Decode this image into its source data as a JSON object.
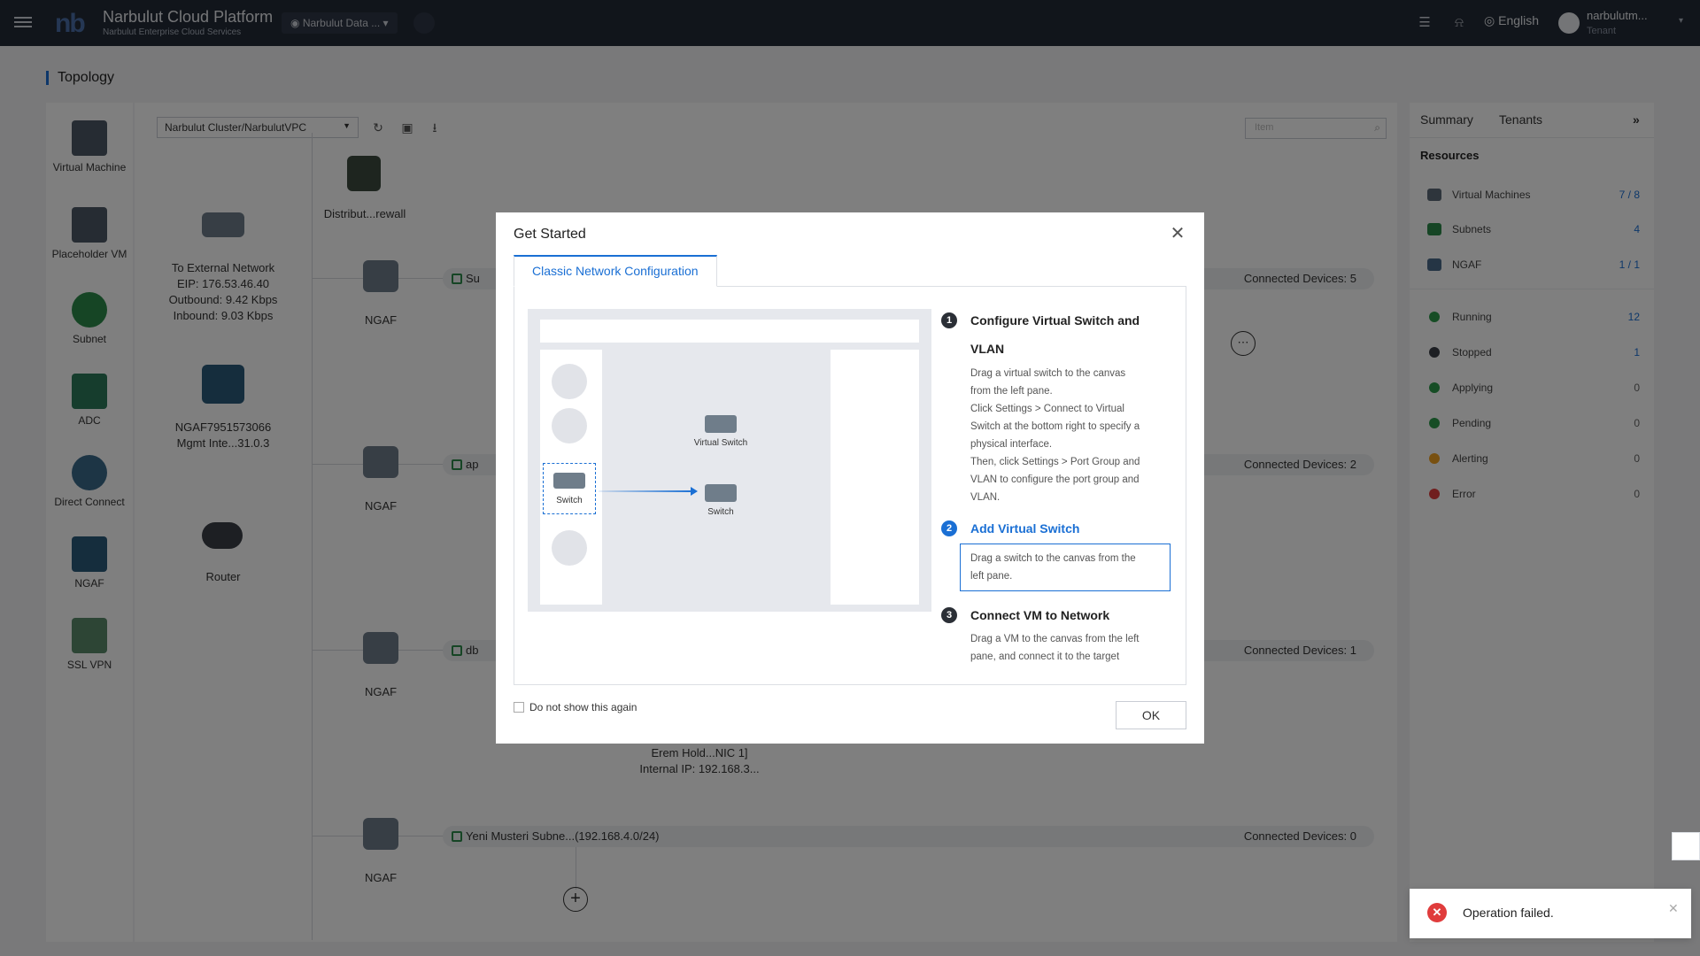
{
  "topbar": {
    "logo": "nb",
    "brand_title": "Narbulut Cloud Platform",
    "brand_subtitle": "Narbulut Enterprise Cloud Services",
    "location": "Narbulut Data ...",
    "language": "English",
    "username": "narbulutm...",
    "user_role": "Tenant"
  },
  "page": {
    "title": "Topology"
  },
  "palette": {
    "items": [
      {
        "label": "Virtual Machine",
        "icon": "virtual-machine-icon"
      },
      {
        "label": "Placeholder VM",
        "icon": "placeholder-vm-icon"
      },
      {
        "label": "Subnet",
        "icon": "subnet-icon"
      },
      {
        "label": "ADC",
        "icon": "adc-icon"
      },
      {
        "label": "Direct Connect",
        "icon": "direct-connect-icon"
      },
      {
        "label": "NGAF",
        "icon": "ngaf-icon"
      },
      {
        "label": "SSL VPN",
        "icon": "ssl-vpn-icon"
      }
    ]
  },
  "toolbar": {
    "cluster_select": "Narbulut Cluster/NarbulutVPC",
    "search_placeholder": "Item"
  },
  "topology": {
    "firewall_label": "Distribut...rewall",
    "external": {
      "title": "To External Network",
      "eip": "EIP: 176.53.46.40",
      "outbound": "Outbound: 9.42 Kbps",
      "inbound": "Inbound: 9.03 Kbps"
    },
    "ngaf_node": {
      "name": "NGAF7951573066",
      "mgmt": "Mgmt Inte...31.0.3"
    },
    "router_label": "Router",
    "ngaf_label": "NGAF",
    "subnets": [
      {
        "name": "Su",
        "devices": "Connected Devices: 5"
      },
      {
        "name": "ap",
        "devices": "Connected Devices: 2"
      },
      {
        "name": "db",
        "devices": "Connected Devices: 1"
      },
      {
        "name": "Yeni Musteri Subne...(192.168.4.0/24)",
        "devices": "Connected Devices: 0"
      }
    ],
    "vm_label": {
      "line1": "Erem Hold...NIC 1]",
      "line2": "Internal IP: 192.168.3..."
    }
  },
  "right_panel": {
    "tabs": [
      "Summary",
      "Tenants"
    ],
    "section_title": "Resources",
    "resources": [
      {
        "label": "Virtual Machines",
        "value": "7 / 8",
        "color": "#5d6b78"
      },
      {
        "label": "Subnets",
        "value": "4",
        "color": "#2c8a4a"
      },
      {
        "label": "NGAF",
        "value": "1 / 1",
        "color": "#4a6a8a"
      }
    ],
    "statuses": [
      {
        "label": "Running",
        "value": "12",
        "color": "#2c9a4a"
      },
      {
        "label": "Stopped",
        "value": "1",
        "color": "#3a3f47"
      },
      {
        "label": "Applying",
        "value": "0",
        "color": "#2c9a4a"
      },
      {
        "label": "Pending",
        "value": "0",
        "color": "#2c9a4a"
      },
      {
        "label": "Alerting",
        "value": "0",
        "color": "#f0a020"
      },
      {
        "label": "Error",
        "value": "0",
        "color": "#e03c3c"
      }
    ]
  },
  "dialog": {
    "title": "Get Started",
    "tab": "Classic Network Configuration",
    "illustration": {
      "switch_label": "Switch",
      "virtual_switch_label": "Virtual Switch",
      "switch2_label": "Switch"
    },
    "steps": [
      {
        "num": "1",
        "title_line1": "Configure Virtual Switch and",
        "title_line2": "VLAN",
        "desc": [
          "Drag a virtual switch to the canvas",
          "from the left pane.",
          "Click Settings > Connect to Virtual",
          "Switch at the bottom right to specify a",
          "physical interface.",
          "Then, click Settings > Port Group and",
          "VLAN to configure the port group and",
          "VLAN."
        ]
      },
      {
        "num": "2",
        "title": "Add Virtual Switch",
        "desc": [
          "Drag a switch to the canvas from the",
          "left pane."
        ]
      },
      {
        "num": "3",
        "title": "Connect VM to Network",
        "desc": [
          "Drag a VM to the canvas from the left",
          "pane, and connect it to the target"
        ]
      }
    ],
    "checkbox_label": "Do not show this again",
    "ok_label": "OK"
  },
  "toast": {
    "message": "Operation failed."
  },
  "colors": {
    "accent": "#1a6fd4",
    "topbar": "#232a36",
    "error": "#e03c3c"
  }
}
